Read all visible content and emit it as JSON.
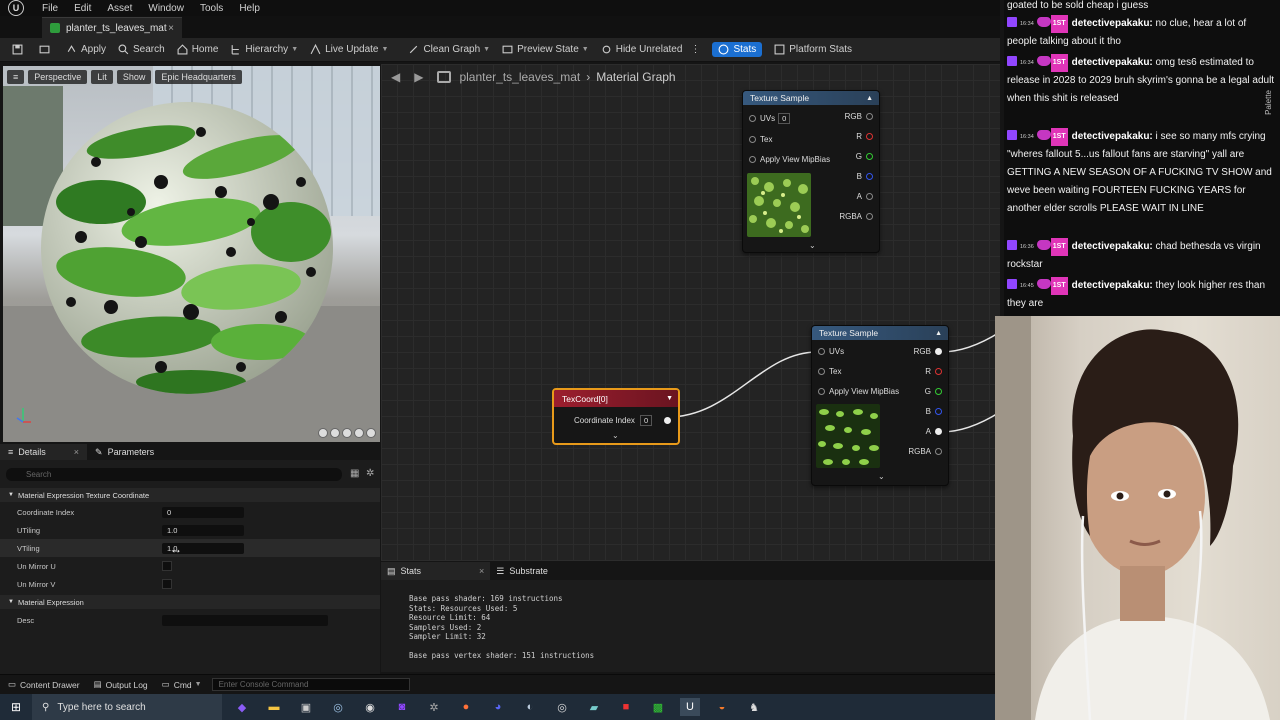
{
  "menubar": {
    "logo": "U",
    "items": [
      "File",
      "Edit",
      "Asset",
      "Window",
      "Tools",
      "Help"
    ]
  },
  "tab": {
    "title": "planter_ts_leaves_mat",
    "close": "×"
  },
  "toolbar": {
    "buttons": [
      "Apply",
      "Search",
      "Home",
      "Hierarchy",
      "Live Update",
      "Clean Graph",
      "Preview State",
      "Hide Unrelated",
      "Stats",
      "Platform Stats"
    ]
  },
  "viewport": {
    "chips": [
      "Perspective",
      "Lit",
      "Show",
      "Epic Headquarters"
    ]
  },
  "details": {
    "tabs": [
      "Details",
      "Parameters"
    ],
    "search_placeholder": "Search",
    "section1": "Material Expression Texture Coordinate",
    "rows": [
      {
        "label": "Coordinate Index",
        "value": "0"
      },
      {
        "label": "UTiling",
        "value": "1.0"
      },
      {
        "label": "VTiling",
        "value": "1.0"
      },
      {
        "label": "Un Mirror U",
        "value": ""
      },
      {
        "label": "Un Mirror V",
        "value": ""
      }
    ],
    "section2": "Material Expression",
    "desc_label": "Desc"
  },
  "graph": {
    "crumb_material": "planter_ts_leaves_mat",
    "crumb_graph": "Material Graph",
    "node1": {
      "title": "Texture Sample",
      "pins_in": [
        "UVs",
        "Tex",
        "Apply View MipBias"
      ],
      "uvs_value": "0",
      "pins_out": [
        "RGB",
        "R",
        "G",
        "B",
        "A",
        "RGBA"
      ]
    },
    "node2": {
      "title": "Texture Sample",
      "pins_in": [
        "UVs",
        "Tex",
        "Apply View MipBias"
      ],
      "pins_out": [
        "RGB",
        "R",
        "G",
        "B",
        "A",
        "RGBA"
      ]
    },
    "texcoord": {
      "title": "TexCoord[0]",
      "pin_label": "Coordinate Index",
      "pin_value": "0"
    }
  },
  "stats": {
    "tabs": [
      "Stats",
      "Substrate"
    ],
    "lines": [
      "Base pass shader: 169 instructions",
      "Stats: Resources Used: 5",
      "Resource Limit: 64",
      "Samplers Used: 2",
      "Sampler Limit: 32",
      "",
      "Base pass vertex shader: 151 instructions"
    ]
  },
  "statusbar": {
    "content_drawer": "Content Drawer",
    "output_log": "Output Log",
    "cmd": "Cmd",
    "console_placeholder": "Enter Console Command"
  },
  "taskbar": {
    "search_placeholder": "Type here to search"
  },
  "chat": {
    "lines": [
      {
        "ts": "",
        "user": "",
        "text": "goated to be sold cheap i guess"
      },
      {
        "ts": "16:34",
        "user": "detectivepakaku:",
        "text": "no clue, hear a lot of people talking about it tho"
      },
      {
        "ts": "16:34",
        "user": "detectivepakaku:",
        "text": "omg tes6 estimated to release in 2028 to 2029 bruh skyrim's gonna be a legal adult when this shit is released"
      },
      {
        "ts": "16:34",
        "user": "detectivepakaku:",
        "text": "i see so many mfs crying \"wheres fallout 5...us fallout fans are starving\" yall are GETTING A NEW SEASON OF A FUCKING TV SHOW and weve been waiting FOURTEEN FUCKING YEARS for another elder scrolls PLEASE WAIT IN LINE"
      },
      {
        "ts": "16:36",
        "user": "detectivepakaku:",
        "text": "chad bethesda vs virgin rockstar"
      },
      {
        "ts": "16:45",
        "user": "detectivepakaku:",
        "text": "they look higher res than they are"
      }
    ],
    "badge": "1ST",
    "side_label": "Palette"
  },
  "colors": {
    "accent": "#1b6fd1",
    "node_selected": "#e89a1a",
    "twitch": "#9146ff"
  }
}
